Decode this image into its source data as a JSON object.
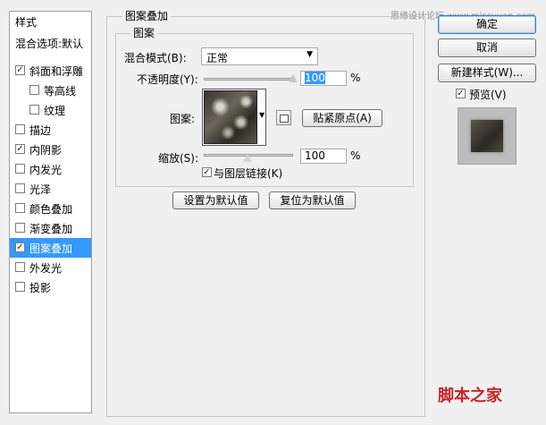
{
  "watermark_top": "思缘设计论坛 www.missyuan.com",
  "watermark_bottom": "脚本之家",
  "styles_panel": {
    "header": "样式",
    "blend_options": "混合选项:默认",
    "items": [
      {
        "label": "斜面和浮雕",
        "checked": true
      },
      {
        "label": "等高线",
        "checked": false
      },
      {
        "label": "纹理",
        "checked": false
      },
      {
        "label": "描边",
        "checked": false
      },
      {
        "label": "内阴影",
        "checked": true
      },
      {
        "label": "内发光",
        "checked": false
      },
      {
        "label": "光泽",
        "checked": false
      },
      {
        "label": "颜色叠加",
        "checked": false
      },
      {
        "label": "渐变叠加",
        "checked": false
      },
      {
        "label": "图案叠加",
        "checked": true
      },
      {
        "label": "外发光",
        "checked": false
      },
      {
        "label": "投影",
        "checked": false
      }
    ]
  },
  "pattern_overlay": {
    "title": "图案叠加",
    "group_title": "图案",
    "blend_mode_label": "混合模式(B):",
    "blend_mode_value": "正常",
    "opacity_label": "不透明度(Y):",
    "opacity_value": "100",
    "opacity_unit": "%",
    "opacity_level": 1.0,
    "pattern_label": "图案:",
    "snap_origin_button": "贴紧原点(A)",
    "scale_label": "缩放(S):",
    "scale_value": "100",
    "scale_unit": "%",
    "link_layer_label": "与图层链接(K)",
    "link_layer_checked": true,
    "set_default_button": "设置为默认值",
    "reset_default_button": "复位为默认值"
  },
  "right_panel": {
    "ok_button": "确定",
    "cancel_button": "取消",
    "new_style_button": "新建样式(W)...",
    "preview_label": "预览(V)",
    "preview_checked": true
  },
  "colors": {
    "selection": "#3399ff",
    "background": "#f0f0f0"
  }
}
